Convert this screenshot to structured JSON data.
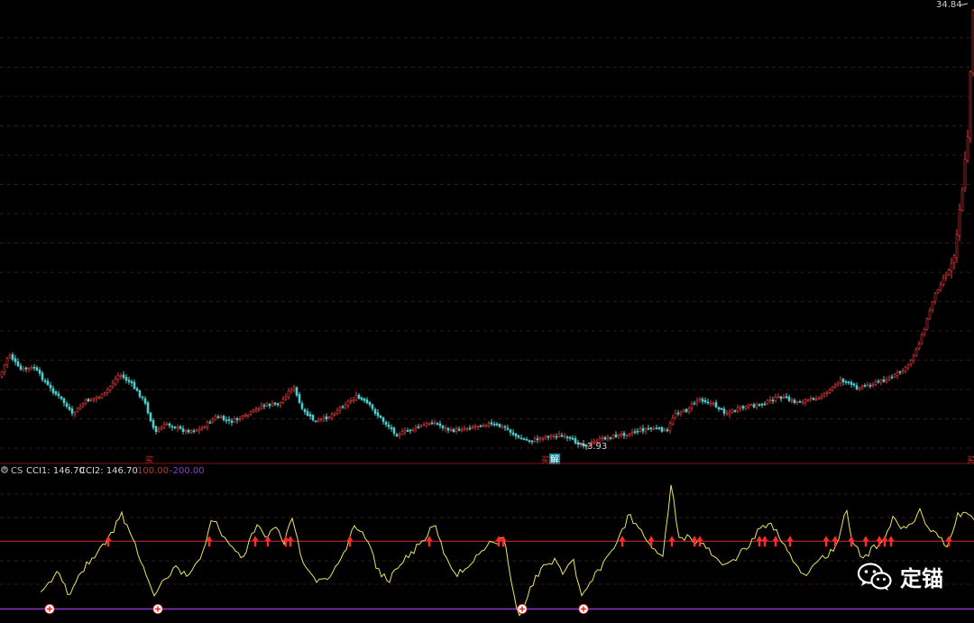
{
  "chart_data": [
    {
      "type": "candlestick",
      "price_high_label": "34.84",
      "price_low_label": "3.93",
      "markers": [
        {
          "type": "signal",
          "text": "买",
          "x": 165
        },
        {
          "type": "signal",
          "text": "买",
          "x": 604
        },
        {
          "type": "signal",
          "text": "解",
          "x": 615
        },
        {
          "type": "signal",
          "text": "买",
          "x": 1076
        }
      ],
      "ylim": [
        3.0,
        35.0
      ]
    },
    {
      "type": "line",
      "indicator": "CS",
      "legend": [
        {
          "text": "CS",
          "color": "#c0c0c0"
        },
        {
          "text": "CCI1: 146.70",
          "color": "#d8d8d8"
        },
        {
          "text": "CCI2: 146.70",
          "color": "#d8d8d8"
        },
        {
          "text": "100.00",
          "color": "#d62a2a"
        },
        {
          "text": "-200.00",
          "color": "#8e3bd6"
        }
      ],
      "reference_lines": [
        {
          "value": 100.0,
          "color": "#d62a2a"
        },
        {
          "value": -200.0,
          "color": "#8e3bd6"
        }
      ],
      "ylim": [
        -250,
        380
      ]
    }
  ],
  "watermark": {
    "text": "定锚",
    "icon": "wechat-icon"
  },
  "colors": {
    "background": "#000000",
    "up": "#e03a3a",
    "down": "#4ecfcf",
    "cci_line": "#e8e860",
    "grid": "#3a1a1a"
  }
}
